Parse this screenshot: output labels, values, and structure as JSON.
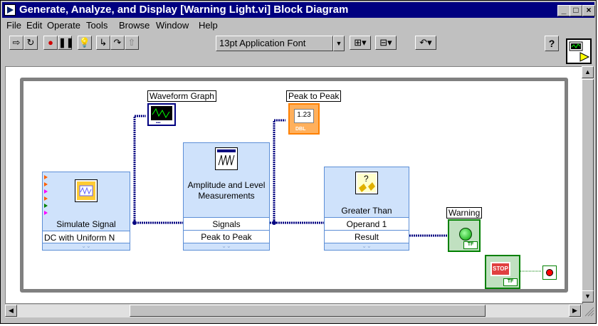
{
  "window": {
    "title": "Generate, Analyze, and Display [Warning Light.vi] Block Diagram",
    "minimize": "_",
    "maximize": "□",
    "close": "×"
  },
  "menu": [
    "File",
    "Edit",
    "Operate",
    "Tools",
    "Browse",
    "Window",
    "Help"
  ],
  "toolbar": {
    "font": "13pt Application Font",
    "help": "?"
  },
  "diagram": {
    "simulate_signal": {
      "title": "Simulate Signal",
      "output": "DC with Uniform N"
    },
    "amplitude": {
      "title": "Amplitude and Level Measurements",
      "input": "Signals",
      "output": "Peak to Peak"
    },
    "greater_than": {
      "title": "Greater Than",
      "input": "Operand 1",
      "output": "Result"
    },
    "waveform_graph_label": "Waveform Graph",
    "peak_label": "Peak to Peak",
    "peak_value": "1.23",
    "peak_type": "DBL",
    "warning_label": "Warning",
    "tf": "TF",
    "stop": "STOP"
  },
  "colors": {
    "title_bar": "#000080",
    "express_vi": "#cfe2fb",
    "waveform_wire": "#000080",
    "numeric_wire": "#ff8000",
    "boolean_wire": "#008000",
    "loop_border": "#808080"
  }
}
